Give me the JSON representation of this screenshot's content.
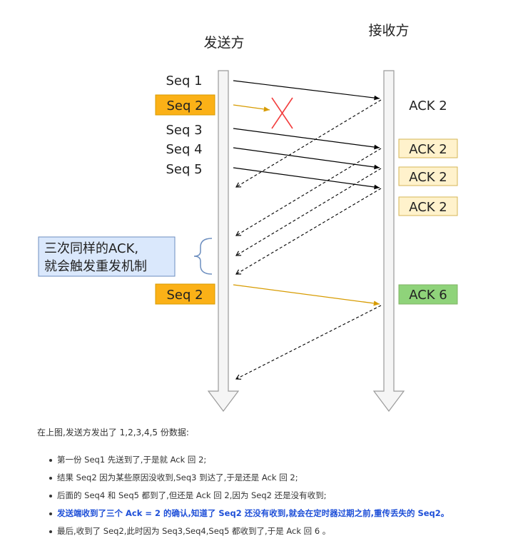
{
  "headers": {
    "sender": "发送方",
    "receiver": "接收方"
  },
  "sender_labels": [
    "Seq 1",
    "Seq 2",
    "Seq 3",
    "Seq 4",
    "Seq 5",
    "Seq 2"
  ],
  "receiver_labels": [
    "ACK 2",
    "ACK 2",
    "ACK 2",
    "ACK 2",
    "ACK 6"
  ],
  "note": {
    "line1": "三次同样的ACK,",
    "line2": "就会触发重发机制"
  },
  "colors": {
    "orange_fill": "#fbb117",
    "orange_border": "#d79b00",
    "yellow_fill": "#fff2cc",
    "yellow_border": "#d6b656",
    "green_fill": "#8fd37a",
    "green_border": "#82b366",
    "note_fill": "#dae8fc",
    "note_border": "#6c8ebf",
    "emphasis": "#1e4fd8"
  },
  "caption": "在上图,发送方发出了 1,2,3,4,5 份数据:",
  "bullets": [
    "第一份 Seq1 先送到了,于是就 Ack 回 2;",
    "结果 Seq2 因为某些原因没收到,Seq3 到达了,于是还是 Ack 回 2;",
    "后面的 Seq4 和 Seq5 都到了,但还是 Ack 回 2,因为 Seq2 还是没有收到;",
    "发送端收到了三个 Ack = 2 的确认,知道了 Seq2 还没有收到,就会在定时器过期之前,重传丢失的 Seq2。",
    "最后,收到了 Seq2,此时因为 Seq3,Seq4,Seq5 都收到了,于是 Ack 回 6 。"
  ]
}
